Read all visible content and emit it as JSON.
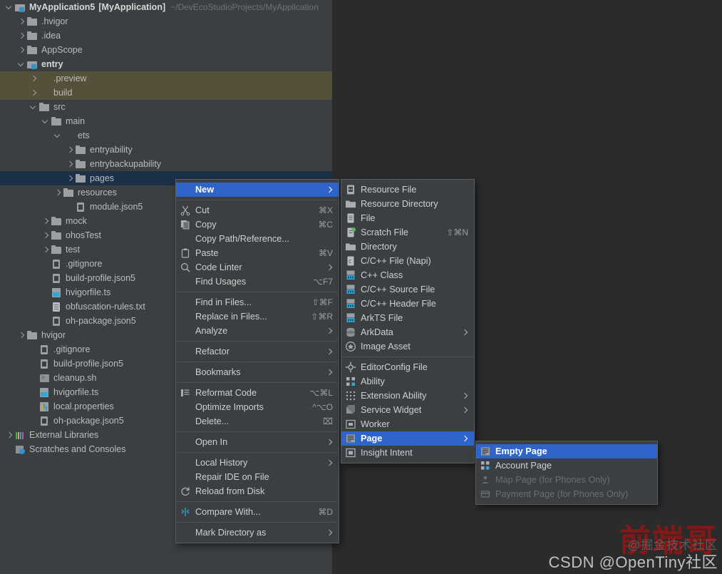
{
  "project": {
    "name": "MyApplication5",
    "module": "[MyApplication]",
    "path": "~/DevEcoStudioProjects/MyApplication"
  },
  "tree": [
    {
      "label": "MyApplication5",
      "bold_label": "[MyApplication]",
      "path": "~/DevEcoStudioProjects/MyApplication",
      "indent": 0,
      "arrow": "d",
      "icon": "module",
      "kind": "root"
    },
    {
      "label": ".hvigor",
      "indent": 1,
      "arrow": "r",
      "icon": "folder"
    },
    {
      "label": ".idea",
      "indent": 1,
      "arrow": "r",
      "icon": "folder"
    },
    {
      "label": "AppScope",
      "indent": 1,
      "arrow": "r",
      "icon": "folder"
    },
    {
      "label": "entry",
      "indent": 1,
      "arrow": "d",
      "icon": "module",
      "bold": true
    },
    {
      "label": ".preview",
      "indent": 2,
      "arrow": "r",
      "icon": "folder-orange",
      "state": "excluded"
    },
    {
      "label": "build",
      "indent": 2,
      "arrow": "r",
      "icon": "folder-orange",
      "state": "excluded"
    },
    {
      "label": "src",
      "indent": 2,
      "arrow": "d",
      "icon": "folder"
    },
    {
      "label": "main",
      "indent": 3,
      "arrow": "d",
      "icon": "folder"
    },
    {
      "label": "ets",
      "indent": 4,
      "arrow": "d",
      "icon": "folder-cyan"
    },
    {
      "label": "entryability",
      "indent": 5,
      "arrow": "r",
      "icon": "folder"
    },
    {
      "label": "entrybackupability",
      "indent": 5,
      "arrow": "r",
      "icon": "folder"
    },
    {
      "label": "pages",
      "indent": 5,
      "arrow": "r",
      "icon": "folder",
      "state": "selected"
    },
    {
      "label": "resources",
      "indent": 4,
      "arrow": "r",
      "icon": "folder"
    },
    {
      "label": "module.json5",
      "indent": 5,
      "arrow": "none",
      "icon": "json"
    },
    {
      "label": "mock",
      "indent": 3,
      "arrow": "r",
      "icon": "folder"
    },
    {
      "label": "ohosTest",
      "indent": 3,
      "arrow": "r",
      "icon": "folder"
    },
    {
      "label": "test",
      "indent": 3,
      "arrow": "r",
      "icon": "folder"
    },
    {
      "label": ".gitignore",
      "indent": 3,
      "arrow": "none",
      "icon": "json"
    },
    {
      "label": "build-profile.json5",
      "indent": 3,
      "arrow": "none",
      "icon": "json"
    },
    {
      "label": "hvigorfile.ts",
      "indent": 3,
      "arrow": "none",
      "icon": "ts"
    },
    {
      "label": "obfuscation-rules.txt",
      "indent": 3,
      "arrow": "none",
      "icon": "file"
    },
    {
      "label": "oh-package.json5",
      "indent": 3,
      "arrow": "none",
      "icon": "json"
    },
    {
      "label": "hvigor",
      "indent": 1,
      "arrow": "r",
      "icon": "folder"
    },
    {
      "label": ".gitignore",
      "indent": 2,
      "arrow": "none",
      "icon": "json"
    },
    {
      "label": "build-profile.json5",
      "indent": 2,
      "arrow": "none",
      "icon": "json"
    },
    {
      "label": "cleanup.sh",
      "indent": 2,
      "arrow": "none",
      "icon": "sh"
    },
    {
      "label": "hvigorfile.ts",
      "indent": 2,
      "arrow": "none",
      "icon": "ts"
    },
    {
      "label": "local.properties",
      "indent": 2,
      "arrow": "none",
      "icon": "props"
    },
    {
      "label": "oh-package.json5",
      "indent": 2,
      "arrow": "none",
      "icon": "json"
    },
    {
      "label": "External Libraries",
      "indent": 0,
      "arrow": "r",
      "icon": "libs"
    },
    {
      "label": "Scratches and Consoles",
      "indent": 0,
      "arrow": "none",
      "icon": "scratch"
    }
  ],
  "context_menu": {
    "items": [
      {
        "label": "New",
        "arrow": true,
        "highlight": true,
        "bold": true,
        "icon": ""
      },
      {
        "type": "separator"
      },
      {
        "label": "Cut",
        "shortcut": "⌘X",
        "icon": "scissors-icon"
      },
      {
        "label": "Copy",
        "shortcut": "⌘C",
        "icon": "copy-icon"
      },
      {
        "label": "Copy Path/Reference...",
        "icon": ""
      },
      {
        "label": "Paste",
        "shortcut": "⌘V",
        "icon": "clipboard-icon"
      },
      {
        "label": "Code Linter",
        "arrow": true,
        "icon": "magnifier-icon"
      },
      {
        "label": "Find Usages",
        "shortcut": "⌥F7",
        "icon": ""
      },
      {
        "type": "separator"
      },
      {
        "label": "Find in Files...",
        "shortcut": "⇧⌘F",
        "icon": ""
      },
      {
        "label": "Replace in Files...",
        "shortcut": "⇧⌘R",
        "icon": ""
      },
      {
        "label": "Analyze",
        "arrow": true,
        "icon": ""
      },
      {
        "type": "separator"
      },
      {
        "label": "Refactor",
        "arrow": true,
        "icon": ""
      },
      {
        "type": "separator"
      },
      {
        "label": "Bookmarks",
        "arrow": true,
        "icon": ""
      },
      {
        "type": "separator"
      },
      {
        "label": "Reformat Code",
        "shortcut": "⌥⌘L",
        "icon": "lines-icon"
      },
      {
        "label": "Optimize Imports",
        "shortcut": "^⌥O",
        "icon": ""
      },
      {
        "label": "Delete...",
        "shortcut": "⌧",
        "icon": ""
      },
      {
        "type": "separator"
      },
      {
        "label": "Open In",
        "arrow": true,
        "icon": ""
      },
      {
        "type": "separator"
      },
      {
        "label": "Local History",
        "arrow": true,
        "icon": ""
      },
      {
        "label": "Repair IDE on File",
        "icon": ""
      },
      {
        "label": "Reload from Disk",
        "icon": "refresh-icon"
      },
      {
        "type": "separator"
      },
      {
        "label": "Compare With...",
        "shortcut": "⌘D",
        "icon": "compare-icon"
      },
      {
        "type": "separator"
      },
      {
        "label": "Mark Directory as",
        "arrow": true,
        "icon": ""
      }
    ]
  },
  "new_submenu": {
    "items": [
      {
        "label": "Resource File",
        "icon": "json-file-icon"
      },
      {
        "label": "Resource Directory",
        "icon": "folder-icon"
      },
      {
        "label": "File",
        "icon": "file-icon"
      },
      {
        "label": "Scratch File",
        "shortcut": "⇧⌘N",
        "icon": "scratch-file-icon"
      },
      {
        "label": "Directory",
        "icon": "folder-icon"
      },
      {
        "label": "C/C++ File (Napi)",
        "icon": "c-file-icon"
      },
      {
        "label": "C++ Class",
        "icon": "cpp-class-icon"
      },
      {
        "label": "C/C++ Source File",
        "icon": "cpp-source-icon"
      },
      {
        "label": "C/C++ Header File",
        "icon": "cpp-header-icon"
      },
      {
        "label": "ArkTS File",
        "icon": "arkts-icon"
      },
      {
        "label": "ArkData",
        "arrow": true,
        "icon": "database-icon"
      },
      {
        "label": "Image Asset",
        "icon": "image-asset-icon"
      },
      {
        "type": "separator"
      },
      {
        "label": "EditorConfig File",
        "icon": "gear-icon"
      },
      {
        "label": "Ability",
        "icon": "ability-icon"
      },
      {
        "label": "Extension Ability",
        "arrow": true,
        "icon": "extension-ability-icon"
      },
      {
        "label": "Service Widget",
        "arrow": true,
        "icon": "service-widget-icon"
      },
      {
        "label": "Worker",
        "icon": "worker-icon"
      },
      {
        "label": "Page",
        "arrow": true,
        "highlight": true,
        "bold": true,
        "icon": "page-icon"
      },
      {
        "label": "Insight Intent",
        "icon": "insight-intent-icon"
      }
    ]
  },
  "page_submenu": {
    "items": [
      {
        "label": "Empty Page",
        "highlight": true,
        "bold": true,
        "icon": "empty-page-icon"
      },
      {
        "label": "Account Page",
        "icon": "account-page-icon"
      },
      {
        "label": "Map Page (for Phones Only)",
        "disabled": true,
        "icon": "map-page-icon"
      },
      {
        "label": "Payment Page (for Phones Only)",
        "disabled": true,
        "icon": "payment-page-icon"
      }
    ]
  },
  "watermark": {
    "big": "前端哥",
    "mid": "@掘金技术社区",
    "small": "CSDN @OpenTiny社区"
  },
  "colors": {
    "panel_bg": "#3c3f41",
    "editor_bg": "#2b2b2b",
    "selection_blue": "#2f65ca",
    "tree_selection": "#1c3048",
    "excluded_olive": "#54503a",
    "text": "#bbbbbb",
    "watermark_red": "#8e1616"
  }
}
